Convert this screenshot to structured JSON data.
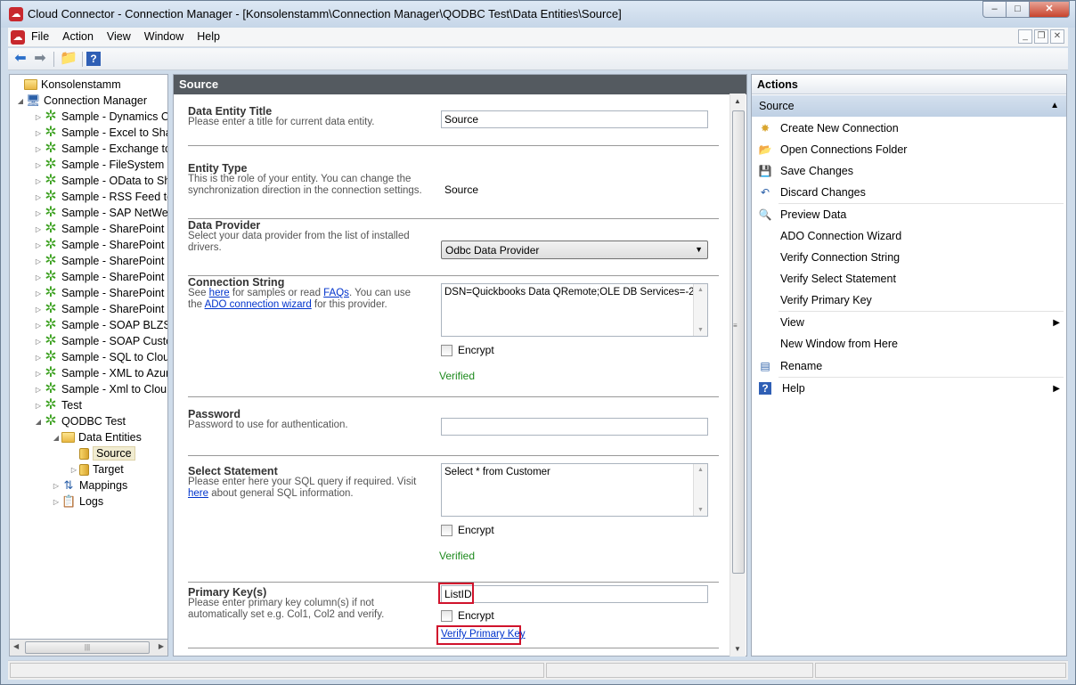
{
  "window": {
    "title": "Cloud Connector - Connection Manager - [Konsolenstamm\\Connection Manager\\QODBC Test\\Data Entities\\Source]",
    "min_label": "–",
    "max_label": "□",
    "close_label": "✕"
  },
  "menu": {
    "items": [
      "File",
      "Action",
      "View",
      "Window",
      "Help"
    ]
  },
  "tree": {
    "root": "Konsolenstamm",
    "connection_manager": "Connection Manager",
    "samples": [
      "Sample - Dynamics C",
      "Sample - Excel to Shar",
      "Sample - Exchange to",
      "Sample - FileSystem t",
      "Sample - OData to Sh",
      "Sample - RSS Feed to",
      "Sample - SAP NetWea",
      "Sample - SharePoint (",
      "Sample - SharePoint (",
      "Sample - SharePoint (",
      "Sample - SharePoint (",
      "Sample - SharePoint t",
      "Sample - SharePoint t",
      "Sample - SOAP BLZSe",
      "Sample - SOAP Custo",
      "Sample - SQL to Clou",
      "Sample - XML to Azur",
      "Sample - Xml to Clou",
      "Test"
    ],
    "qodbc": "QODBC Test",
    "data_entities": "Data Entities",
    "source": "Source",
    "target": "Target",
    "mappings": "Mappings",
    "logs": "Logs"
  },
  "main": {
    "header": "Source",
    "title_section": {
      "label": "Data Entity Title",
      "desc": "Please enter a title for current data entity.",
      "value": "Source"
    },
    "entity_type": {
      "label": "Entity Type",
      "desc": "This is the role of your entity. You can change the synchronization direction in the connection settings.",
      "value": "Source"
    },
    "data_provider": {
      "label": "Data Provider",
      "desc": "Select your data provider from the list of installed drivers.",
      "value": "Odbc Data Provider"
    },
    "connection_string": {
      "label": "Connection String",
      "desc_1": "See ",
      "link_here": "here",
      "desc_2": " for samples or read ",
      "link_faqs": "FAQs",
      "desc_3": ". You can use the ",
      "link_wizard": "ADO connection wizard",
      "desc_4": " for this provider.",
      "value": "DSN=Quickbooks Data QRemote;OLE DB Services=-2;",
      "encrypt": "Encrypt",
      "status": "Verified"
    },
    "password": {
      "label": "Password",
      "desc": "Password to use for authentication.",
      "value": ""
    },
    "select_statement": {
      "label": "Select Statement",
      "desc_1": "Please enter here your SQL query if required. Visit ",
      "link_here": "here",
      "desc_2": " about general SQL information.",
      "value": "Select * from Customer",
      "encrypt": "Encrypt",
      "status": "Verified"
    },
    "primary_key": {
      "label": "Primary Key(s)",
      "desc": "Please enter primary key column(s) if not automatically set e.g. Col1, Col2 and verify.",
      "value": "ListID",
      "encrypt": "Encrypt",
      "verify_link": "Verify Primary Key"
    }
  },
  "actions": {
    "header": "Actions",
    "section": "Source",
    "items": [
      {
        "label": "Create New Connection",
        "icon": "new-connection-icon"
      },
      {
        "label": "Open Connections Folder",
        "icon": "folder-open-icon"
      },
      {
        "label": "Save Changes",
        "icon": "save-icon"
      },
      {
        "label": "Discard Changes",
        "icon": "undo-icon"
      },
      {
        "label": "Preview Data",
        "icon": "preview-icon"
      },
      {
        "label": "ADO Connection Wizard",
        "icon": ""
      },
      {
        "label": "Verify Connection String",
        "icon": ""
      },
      {
        "label": "Verify Select Statement",
        "icon": ""
      },
      {
        "label": "Verify Primary Key",
        "icon": ""
      },
      {
        "label": "View",
        "icon": ""
      },
      {
        "label": "New Window from Here",
        "icon": ""
      },
      {
        "label": "Rename",
        "icon": "rename-icon"
      },
      {
        "label": "Help",
        "icon": "help-icon"
      }
    ]
  },
  "colors": {
    "verified": "#1d8a1d",
    "highlight": "#d0132c",
    "header_dark": "#545a60",
    "link": "#0033cc"
  }
}
